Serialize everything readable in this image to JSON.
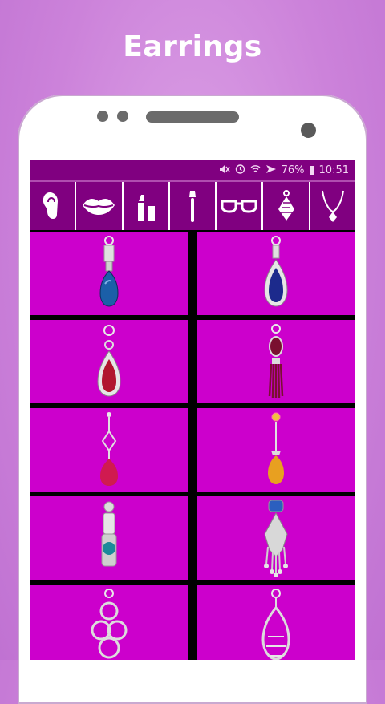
{
  "headline": "Earrings",
  "status": {
    "icons": [
      "mute-icon",
      "alarm-icon",
      "wifi-icon",
      "airplane-icon"
    ],
    "battery_percent": "76%",
    "time": "10:51"
  },
  "categories": [
    {
      "name": "ear-icon"
    },
    {
      "name": "lips-icon"
    },
    {
      "name": "lipstick-icon"
    },
    {
      "name": "makeup-brush-icon"
    },
    {
      "name": "glasses-icon"
    },
    {
      "name": "earring-icon"
    },
    {
      "name": "necklace-icon"
    }
  ],
  "colors": {
    "accent": "#800080",
    "tile": "#cc00cc",
    "background": "#cc82da"
  },
  "earrings": [
    {
      "name": "blue-teardrop-earring",
      "gem": "#1b5fa8"
    },
    {
      "name": "sapphire-pear-earring",
      "gem": "#1c2a8c"
    },
    {
      "name": "ruby-pear-earring",
      "gem": "#b1162e"
    },
    {
      "name": "ruby-tassel-earring",
      "gem": "#7a1030"
    },
    {
      "name": "pink-drop-earring",
      "gem": "#d01a50"
    },
    {
      "name": "amber-drop-earring",
      "gem": "#e8a020"
    },
    {
      "name": "teal-cylinder-earring",
      "gem": "#1b8a9a"
    },
    {
      "name": "blue-chandelier-earring",
      "gem": "#2b5fbf"
    },
    {
      "name": "diamond-loop-earring",
      "gem": "#dcdcdc"
    },
    {
      "name": "diamond-chandelier-earring",
      "gem": "#dcdcdc"
    }
  ]
}
